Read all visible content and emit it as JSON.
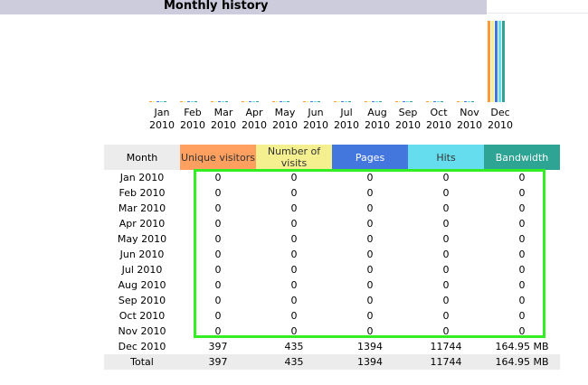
{
  "title": "Monthly history",
  "chart_data": {
    "type": "bar",
    "categories": [
      "Jan 2010",
      "Feb 2010",
      "Mar 2010",
      "Apr 2010",
      "May 2010",
      "Jun 2010",
      "Jul 2010",
      "Aug 2010",
      "Sep 2010",
      "Oct 2010",
      "Nov 2010",
      "Dec 2010"
    ],
    "series": [
      {
        "name": "Unique visitors",
        "values": [
          0,
          0,
          0,
          0,
          0,
          0,
          0,
          0,
          0,
          0,
          0,
          397
        ],
        "color": "#ff9933"
      },
      {
        "name": "Number of visits",
        "values": [
          0,
          0,
          0,
          0,
          0,
          0,
          0,
          0,
          0,
          0,
          0,
          435
        ],
        "color": "#f4f090"
      },
      {
        "name": "Pages",
        "values": [
          0,
          0,
          0,
          0,
          0,
          0,
          0,
          0,
          0,
          0,
          0,
          1394
        ],
        "color": "#4477dd"
      },
      {
        "name": "Hits",
        "values": [
          0,
          0,
          0,
          0,
          0,
          0,
          0,
          0,
          0,
          0,
          0,
          11744
        ],
        "color": "#66ddee"
      },
      {
        "name": "Bandwidth",
        "values": [
          0,
          0,
          0,
          0,
          0,
          0,
          0,
          0,
          0,
          0,
          0,
          164.95
        ],
        "color": "#2ea495"
      }
    ]
  },
  "axis": {
    "months": [
      "Jan",
      "Feb",
      "Mar",
      "Apr",
      "May",
      "Jun",
      "Jul",
      "Aug",
      "Sep",
      "Oct",
      "Nov",
      "Dec"
    ],
    "year": "2010"
  },
  "table": {
    "headers": {
      "month": "Month",
      "unique": "Unique visitors",
      "visits": "Number of visits",
      "pages": "Pages",
      "hits": "Hits",
      "bandwidth": "Bandwidth"
    },
    "rows": [
      {
        "month": "Jan 2010",
        "unique": "0",
        "visits": "0",
        "pages": "0",
        "hits": "0",
        "bandwidth": "0"
      },
      {
        "month": "Feb 2010",
        "unique": "0",
        "visits": "0",
        "pages": "0",
        "hits": "0",
        "bandwidth": "0"
      },
      {
        "month": "Mar 2010",
        "unique": "0",
        "visits": "0",
        "pages": "0",
        "hits": "0",
        "bandwidth": "0"
      },
      {
        "month": "Apr 2010",
        "unique": "0",
        "visits": "0",
        "pages": "0",
        "hits": "0",
        "bandwidth": "0"
      },
      {
        "month": "May 2010",
        "unique": "0",
        "visits": "0",
        "pages": "0",
        "hits": "0",
        "bandwidth": "0"
      },
      {
        "month": "Jun 2010",
        "unique": "0",
        "visits": "0",
        "pages": "0",
        "hits": "0",
        "bandwidth": "0"
      },
      {
        "month": "Jul 2010",
        "unique": "0",
        "visits": "0",
        "pages": "0",
        "hits": "0",
        "bandwidth": "0"
      },
      {
        "month": "Aug 2010",
        "unique": "0",
        "visits": "0",
        "pages": "0",
        "hits": "0",
        "bandwidth": "0"
      },
      {
        "month": "Sep 2010",
        "unique": "0",
        "visits": "0",
        "pages": "0",
        "hits": "0",
        "bandwidth": "0"
      },
      {
        "month": "Oct 2010",
        "unique": "0",
        "visits": "0",
        "pages": "0",
        "hits": "0",
        "bandwidth": "0"
      },
      {
        "month": "Nov 2010",
        "unique": "0",
        "visits": "0",
        "pages": "0",
        "hits": "0",
        "bandwidth": "0"
      },
      {
        "month": "Dec 2010",
        "unique": "397",
        "visits": "435",
        "pages": "1394",
        "hits": "11744",
        "bandwidth": "164.95 MB"
      }
    ],
    "total": {
      "month": "Total",
      "unique": "397",
      "visits": "435",
      "pages": "1394",
      "hits": "11744",
      "bandwidth": "164.95 MB"
    }
  }
}
